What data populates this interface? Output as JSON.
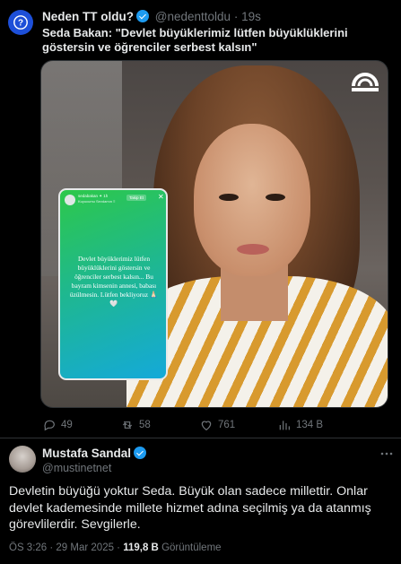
{
  "quoted": {
    "name": "Neden TT oldu?",
    "handle": "@nedenttoldu",
    "separator": "·",
    "time": "19s",
    "text": "Seda Bakan: \"Devlet büyüklerimiz lütfen büyüklüklerini göstersin ve öğrenciler serbest kalsın\"",
    "story": {
      "user": "sedabakan ✦ 1h",
      "sub": "Kuyucumu Sevdamın ≡",
      "follow": "Takip Et",
      "close": "✕",
      "text": "Devlet büyüklerimiz lütfen büyüklüklerini göstersin ve öğrenciler serbest kalsın... Bu bayram kimsenin annesi, babası üzülmesin. Lütfen bekliyoruz 🙏🏻🤍"
    },
    "actions": {
      "replies": "49",
      "reposts": "58",
      "likes": "761",
      "views": "134 B"
    }
  },
  "tweet": {
    "name": "Mustafa Sandal",
    "handle": "@mustinetnet",
    "text": "Devletin büyüğü yoktur Seda. Büyük olan sadece millettir. Onlar devlet kademesinde millete hizmet adına seçilmiş ya da atanmış görevlilerdir. Sevgilerle.",
    "time": "ÖS 3:26 · 29 Mar 2025 ·",
    "views_count": "119,8 B",
    "views_label": "Görüntüleme"
  },
  "icons": {
    "avatar_brand": "question-logo-icon",
    "verified": "verified-badge-icon",
    "reply": "reply-icon",
    "repost": "repost-icon",
    "like": "heart-icon",
    "views": "views-chart-icon",
    "more": "more-icon"
  },
  "colors": {
    "background": "#000000",
    "text": "#e7e9ea",
    "muted": "#71767b",
    "verified": "#1d9bf0",
    "divider": "#2f3336"
  }
}
